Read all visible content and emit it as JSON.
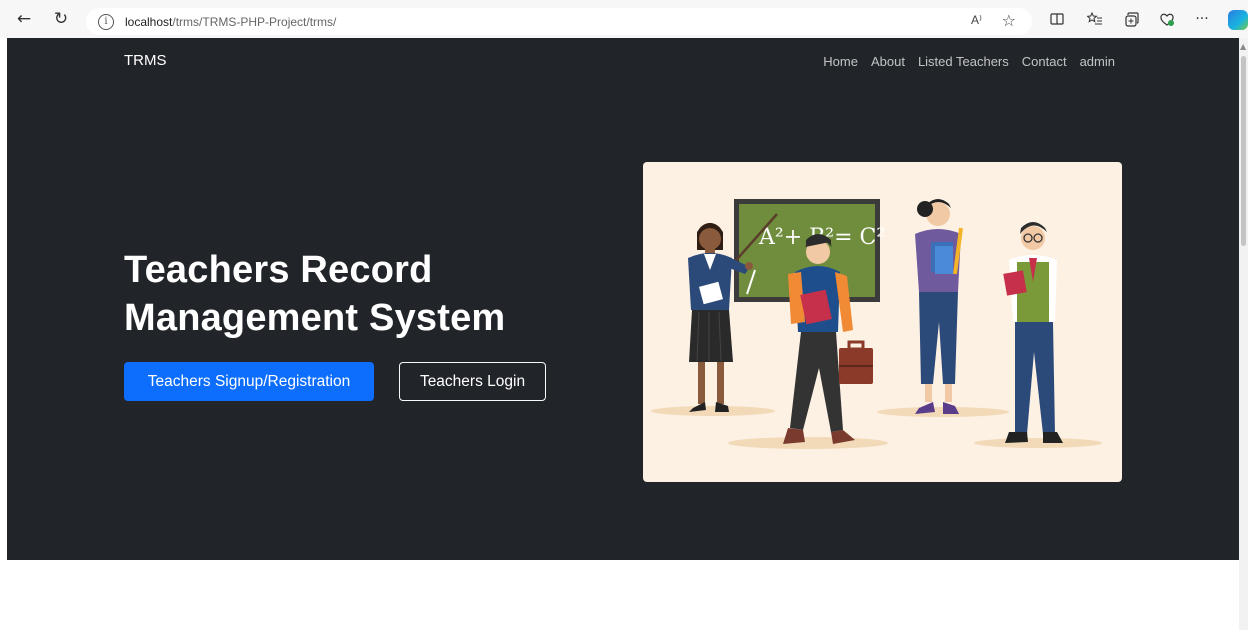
{
  "browser": {
    "url_host": "localhost",
    "url_path": "/trms/TRMS-PHP-Project/trms/",
    "read_aloud_label": "A⁾",
    "more_label": "···"
  },
  "navbar": {
    "brand": "TRMS",
    "links": [
      "Home",
      "About",
      "Listed Teachers",
      "Contact",
      "admin"
    ]
  },
  "hero": {
    "title": "Teachers Record Management System",
    "signup_label": "Teachers Signup/Registration",
    "login_label": "Teachers Login",
    "chalkboard_text": "A²+ B²= C²"
  },
  "colors": {
    "hero_bg": "#212529",
    "primary": "#0d6efd",
    "illustration_bg": "#fdf1e3"
  }
}
